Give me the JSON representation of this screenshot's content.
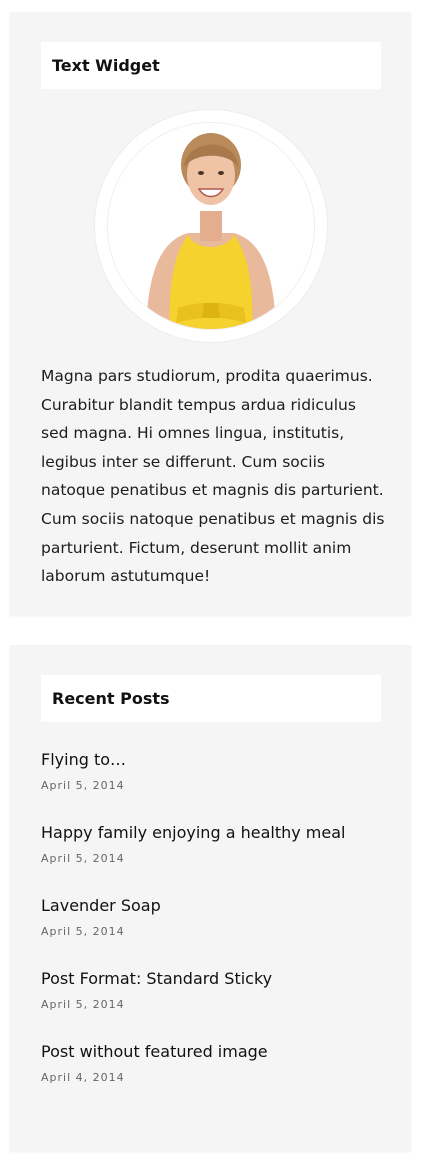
{
  "text_widget": {
    "title": "Text Widget",
    "body": "Magna pars studiorum, prodita quaerimus. Curabitur blandit tempus ardua ridiculus sed magna. Hi omnes lingua, institutis, legibus inter se differunt. Cum sociis natoque penatibus et magnis dis parturient. Cum sociis natoque penatibus et magnis dis parturient. Fictum, deserunt mollit anim laborum astutumque!"
  },
  "recent_posts": {
    "title": "Recent Posts",
    "items": [
      {
        "title": "Flying to…",
        "date": "April 5, 2014"
      },
      {
        "title": "Happy family enjoying a healthy meal",
        "date": "April 5, 2014"
      },
      {
        "title": "Lavender Soap",
        "date": "April 5, 2014"
      },
      {
        "title": "Post Format: Standard Sticky",
        "date": "April 5, 2014"
      },
      {
        "title": "Post without featured image",
        "date": "April 4, 2014"
      }
    ]
  },
  "colors": {
    "widget_bg": "#f5f5f5",
    "title_bg": "#ffffff",
    "shirt_yellow": "#f5d22e"
  }
}
